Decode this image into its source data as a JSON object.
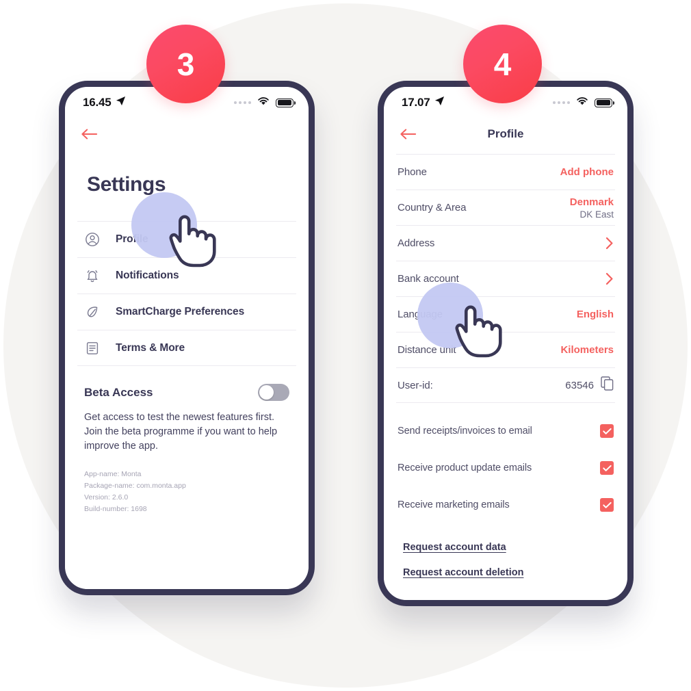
{
  "theme": {
    "accent_red": "#f4615f",
    "badge_red": "#fb4a62",
    "navy": "#393755",
    "background_circle": "#f5f4f2",
    "halo_lavender": "#c3c8f2"
  },
  "steps": [
    {
      "number": "3"
    },
    {
      "number": "4"
    }
  ],
  "phone_left": {
    "status_bar": {
      "time": "16.45",
      "location_icon": "location-arrow-icon",
      "signal_dots": "signal-dots-icon",
      "wifi_icon": "wifi-icon",
      "battery_icon": "battery-full-icon"
    },
    "nav": {
      "back_icon": "back-arrow-icon",
      "title": ""
    },
    "page_title": "Settings",
    "menu": [
      {
        "label": "Profile",
        "icon": "user-circle-icon"
      },
      {
        "label": "Notifications",
        "icon": "bell-icon"
      },
      {
        "label": "SmartCharge Preferences",
        "icon": "leaf-icon"
      },
      {
        "label": "Terms & More",
        "icon": "document-icon"
      }
    ],
    "beta": {
      "title": "Beta Access",
      "toggle_state": "off",
      "description": "Get access to test the newest features first. Join the beta programme if you want to help improve the app."
    },
    "app_info": [
      "App-name: Monta",
      "Package-name: com.monta.app",
      "Version: 2.6.0",
      "Build-number: 1698"
    ]
  },
  "phone_right": {
    "status_bar": {
      "time": "17.07",
      "location_icon": "location-arrow-icon",
      "signal_dots": "signal-dots-icon",
      "wifi_icon": "wifi-icon",
      "battery_icon": "battery-full-icon"
    },
    "nav": {
      "back_icon": "back-arrow-icon",
      "title": "Profile"
    },
    "rows": [
      {
        "label": "Phone",
        "value": "Add phone",
        "sub": "",
        "accessory": "none"
      },
      {
        "label": "Country & Area",
        "value": "Denmark",
        "sub": "DK East",
        "accessory": "none"
      },
      {
        "label": "Address",
        "value": "",
        "sub": "",
        "accessory": "chevron"
      },
      {
        "label": "Bank account",
        "value": "",
        "sub": "",
        "accessory": "chevron"
      },
      {
        "label": "Language",
        "value": "English",
        "sub": "",
        "accessory": "none"
      },
      {
        "label": "Distance unit",
        "value": "Kilometers",
        "sub": "",
        "accessory": "none"
      }
    ],
    "user_id": {
      "label": "User-id:",
      "value": "63546",
      "copy_icon": "copy-icon"
    },
    "checkboxes": [
      {
        "label": "Send receipts/invoices to email",
        "checked": true
      },
      {
        "label": "Receive product update emails",
        "checked": true
      },
      {
        "label": "Receive marketing emails",
        "checked": true
      }
    ],
    "links": [
      {
        "label": "Request account data"
      },
      {
        "label": "Request account deletion"
      }
    ]
  }
}
